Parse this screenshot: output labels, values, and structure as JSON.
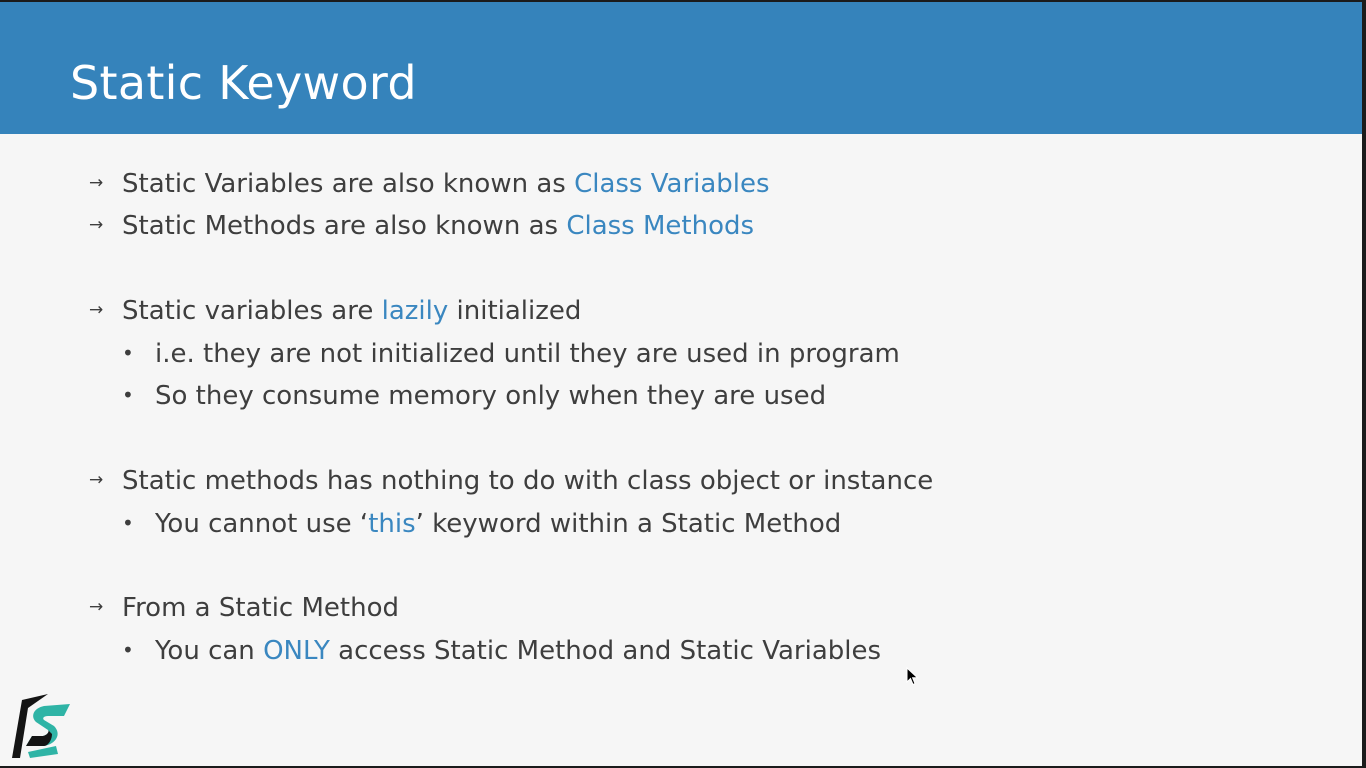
{
  "slide": {
    "title": "Static Keyword",
    "bullet_marker": "→",
    "sub_marker": "•",
    "bullets": [
      {
        "pre": "Static Variables are also known as ",
        "hl": "Class Variables",
        "post": ""
      },
      {
        "pre": "Static Methods are also known as ",
        "hl": "Class Methods",
        "post": ""
      },
      {
        "pre": "Static variables are ",
        "hl": "lazily",
        "post": " initialized"
      },
      {
        "text": "i.e. they are not initialized until they are used in program"
      },
      {
        "text": "So they consume memory only when they are used"
      },
      {
        "text": "Static methods has nothing to do with class object or instance"
      },
      {
        "pre": "You cannot use ‘",
        "hl": "this",
        "post": "’ keyword within a Static Method"
      },
      {
        "text": "From a Static Method"
      },
      {
        "pre": "You can ",
        "hl": "ONLY",
        "post": " access Static Method and Static Variables"
      }
    ]
  },
  "colors": {
    "header": "#3583bb",
    "highlight": "#3a87c0",
    "text": "#3e3e3e",
    "background": "#f6f6f6",
    "logo_teal": "#2fb4a6"
  },
  "icons": {
    "logo": "brand-logo-icon",
    "cursor": "mouse-pointer-icon"
  }
}
